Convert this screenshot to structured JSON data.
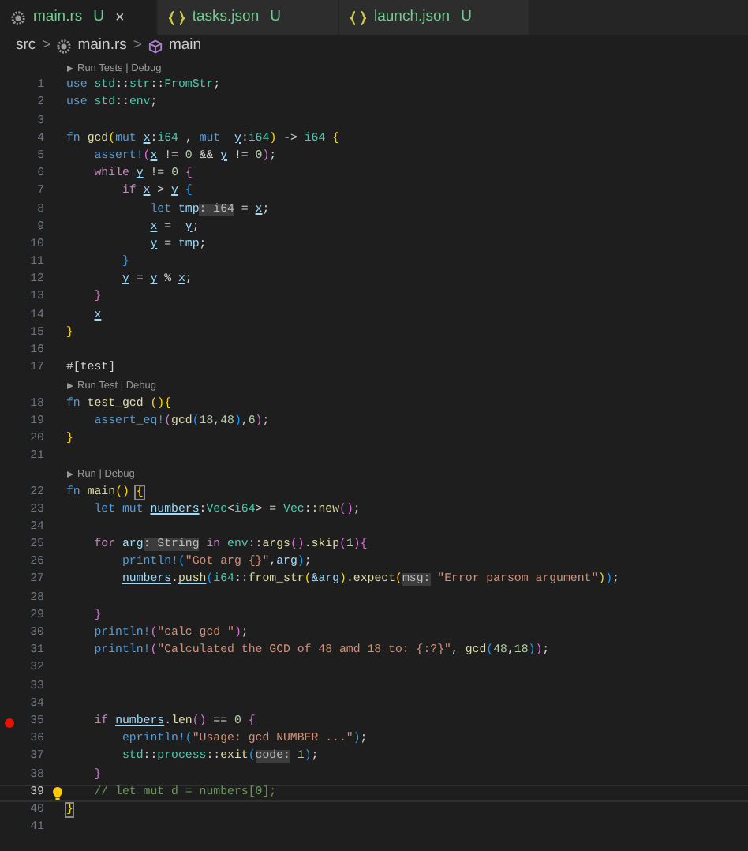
{
  "tabs": [
    {
      "kind": "rust",
      "label": "main.rs",
      "status": "U",
      "close": "×",
      "selected": true
    },
    {
      "kind": "json",
      "label": "tasks.json",
      "status": "U",
      "selected": false
    },
    {
      "kind": "json",
      "label": "launch.json",
      "status": "U",
      "selected": false
    }
  ],
  "breadcrumb": [
    {
      "kind": "folder",
      "label": "src"
    },
    {
      "kind": "file",
      "label": "main.rs"
    },
    {
      "kind": "symbol",
      "label": "main"
    }
  ],
  "breadcrumb_separator": ">",
  "lines": [
    {
      "kind": "codelens",
      "text": "Run Tests | Debug"
    },
    {
      "kind": "code",
      "num": "1",
      "breakpoint": false,
      "current": false,
      "t": [
        {
          "text": "use ",
          "kind": "kw"
        },
        {
          "text": "std",
          "kind": "ty"
        },
        {
          "text": "::",
          "kind": "p"
        },
        {
          "text": "str",
          "kind": "ty"
        },
        {
          "text": "::",
          "kind": "p"
        },
        {
          "text": "FromStr",
          "kind": "ty"
        },
        {
          "text": ";",
          "kind": "p"
        }
      ]
    },
    {
      "kind": "code",
      "num": "2",
      "breakpoint": false,
      "current": false,
      "t": [
        {
          "text": "use ",
          "kind": "kw"
        },
        {
          "text": "std",
          "kind": "ty"
        },
        {
          "text": "::",
          "kind": "p"
        },
        {
          "text": "env",
          "kind": "ty"
        },
        {
          "text": ";",
          "kind": "p"
        }
      ]
    },
    {
      "kind": "code",
      "num": "3",
      "breakpoint": false,
      "current": false
    },
    {
      "kind": "code",
      "num": "4",
      "breakpoint": false,
      "current": false,
      "t": [
        {
          "text": "fn ",
          "kind": "kw"
        },
        {
          "text": "gcd",
          "kind": "fn"
        },
        {
          "text": "(",
          "kind": "b1"
        },
        {
          "text": "mut ",
          "kind": "kw"
        },
        {
          "text": "x",
          "kind": "mv"
        },
        {
          "text": ":",
          "kind": "p"
        },
        {
          "text": "i64",
          "kind": "ty"
        },
        {
          "text": " , ",
          "kind": "p"
        },
        {
          "text": "mut  ",
          "kind": "kw"
        },
        {
          "text": "y",
          "kind": "mv"
        },
        {
          "text": ":",
          "kind": "p"
        },
        {
          "text": "i64",
          "kind": "ty"
        },
        {
          "text": ")",
          "kind": "b1"
        },
        {
          "text": " -> ",
          "kind": "p"
        },
        {
          "text": "i64 ",
          "kind": "ty"
        },
        {
          "text": "{",
          "kind": "b1"
        }
      ]
    },
    {
      "kind": "code",
      "num": "5",
      "breakpoint": false,
      "current": false,
      "t": [
        {
          "text": "    assert!",
          "kind": "mac"
        },
        {
          "text": "(",
          "kind": "b2"
        },
        {
          "text": "x",
          "kind": "mv"
        },
        {
          "text": " != ",
          "kind": "p"
        },
        {
          "text": "0",
          "kind": "num"
        },
        {
          "text": " && ",
          "kind": "p"
        },
        {
          "text": "y",
          "kind": "mv"
        },
        {
          "text": " != ",
          "kind": "p"
        },
        {
          "text": "0",
          "kind": "num"
        },
        {
          "text": ")",
          "kind": "b2"
        },
        {
          "text": ";",
          "kind": "p"
        }
      ]
    },
    {
      "kind": "code",
      "num": "6",
      "breakpoint": false,
      "current": false,
      "t": [
        {
          "text": "    while ",
          "kind": "ctl"
        },
        {
          "text": "y",
          "kind": "mv"
        },
        {
          "text": " != ",
          "kind": "p"
        },
        {
          "text": "0 ",
          "kind": "num"
        },
        {
          "text": "{",
          "kind": "b2"
        }
      ]
    },
    {
      "kind": "code",
      "num": "7",
      "breakpoint": false,
      "current": false,
      "t": [
        {
          "text": "        if ",
          "kind": "ctl"
        },
        {
          "text": "x",
          "kind": "mv"
        },
        {
          "text": " > ",
          "kind": "p"
        },
        {
          "text": "y",
          "kind": "mv"
        },
        {
          "text": " {",
          "kind": "b3"
        }
      ]
    },
    {
      "kind": "code",
      "num": "8",
      "breakpoint": false,
      "current": false,
      "t": [
        {
          "text": "            let ",
          "kind": "kw"
        },
        {
          "text": "tmp",
          "kind": "v"
        },
        {
          "text": ": i64",
          "kind": "hint"
        },
        {
          "text": " = ",
          "kind": "p"
        },
        {
          "text": "x",
          "kind": "mv"
        },
        {
          "text": ";",
          "kind": "p"
        }
      ]
    },
    {
      "kind": "code",
      "num": "9",
      "breakpoint": false,
      "current": false,
      "t": [
        {
          "text": "            x",
          "kind": "mv"
        },
        {
          "text": " =  ",
          "kind": "p"
        },
        {
          "text": "y",
          "kind": "mv"
        },
        {
          "text": ";",
          "kind": "p"
        }
      ]
    },
    {
      "kind": "code",
      "num": "10",
      "breakpoint": false,
      "current": false,
      "t": [
        {
          "text": "            y",
          "kind": "mv"
        },
        {
          "text": " = ",
          "kind": "p"
        },
        {
          "text": "tmp",
          "kind": "v"
        },
        {
          "text": ";",
          "kind": "p"
        }
      ]
    },
    {
      "kind": "code",
      "num": "11",
      "breakpoint": false,
      "current": false,
      "t": [
        {
          "text": "        }",
          "kind": "b3"
        }
      ]
    },
    {
      "kind": "code",
      "num": "12",
      "breakpoint": false,
      "current": false,
      "t": [
        {
          "text": "        y",
          "kind": "mv"
        },
        {
          "text": " = ",
          "kind": "p"
        },
        {
          "text": "y",
          "kind": "mv"
        },
        {
          "text": " % ",
          "kind": "p"
        },
        {
          "text": "x",
          "kind": "mv"
        },
        {
          "text": ";",
          "kind": "p"
        }
      ]
    },
    {
      "kind": "code",
      "num": "13",
      "breakpoint": false,
      "current": false,
      "t": [
        {
          "text": "    }",
          "kind": "b2"
        }
      ]
    },
    {
      "kind": "code",
      "num": "14",
      "breakpoint": false,
      "current": false,
      "t": [
        {
          "text": "    x",
          "kind": "mv"
        }
      ]
    },
    {
      "kind": "code",
      "num": "15",
      "breakpoint": false,
      "current": false,
      "t": [
        {
          "text": "}",
          "kind": "b1"
        }
      ]
    },
    {
      "kind": "code",
      "num": "16",
      "breakpoint": false,
      "current": false
    },
    {
      "kind": "code",
      "num": "17",
      "breakpoint": false,
      "current": false,
      "t": [
        {
          "text": "#[test]",
          "kind": "p"
        }
      ]
    },
    {
      "kind": "codelens",
      "text": "Run Test | Debug"
    },
    {
      "kind": "code",
      "num": "18",
      "breakpoint": false,
      "current": false,
      "t": [
        {
          "text": "fn ",
          "kind": "kw"
        },
        {
          "text": "test_gcd ",
          "kind": "fn"
        },
        {
          "text": "(){",
          "kind": "b1"
        }
      ]
    },
    {
      "kind": "code",
      "num": "19",
      "breakpoint": false,
      "current": false,
      "t": [
        {
          "text": "    assert_eq!",
          "kind": "mac"
        },
        {
          "text": "(",
          "kind": "b2"
        },
        {
          "text": "gcd",
          "kind": "fn"
        },
        {
          "text": "(",
          "kind": "b3"
        },
        {
          "text": "18",
          "kind": "num"
        },
        {
          "text": ",",
          "kind": "p"
        },
        {
          "text": "48",
          "kind": "num"
        },
        {
          "text": ")",
          "kind": "b3"
        },
        {
          "text": ",",
          "kind": "p"
        },
        {
          "text": "6",
          "kind": "num"
        },
        {
          "text": ")",
          "kind": "b2"
        },
        {
          "text": ";",
          "kind": "p"
        }
      ]
    },
    {
      "kind": "code",
      "num": "20",
      "breakpoint": false,
      "current": false,
      "t": [
        {
          "text": "}",
          "kind": "b1"
        }
      ]
    },
    {
      "kind": "code",
      "num": "21",
      "breakpoint": false,
      "current": false
    },
    {
      "kind": "codelens",
      "text": "Run | Debug"
    },
    {
      "kind": "code",
      "num": "22",
      "breakpoint": false,
      "current": false,
      "t": [
        {
          "text": "fn ",
          "kind": "kw"
        },
        {
          "text": "main",
          "kind": "fn"
        },
        {
          "text": "() ",
          "kind": "b1"
        },
        {
          "text": "{",
          "kind": "bm"
        }
      ]
    },
    {
      "kind": "code",
      "num": "23",
      "breakpoint": false,
      "current": false,
      "t": [
        {
          "text": "    let mut ",
          "kind": "kw"
        },
        {
          "text": "numbers",
          "kind": "mv"
        },
        {
          "text": ":",
          "kind": "p"
        },
        {
          "text": "Vec",
          "kind": "ty"
        },
        {
          "text": "<",
          "kind": "p"
        },
        {
          "text": "i64",
          "kind": "ty"
        },
        {
          "text": "> = ",
          "kind": "p"
        },
        {
          "text": "Vec",
          "kind": "ty"
        },
        {
          "text": "::",
          "kind": "p"
        },
        {
          "text": "new",
          "kind": "fn"
        },
        {
          "text": "()",
          "kind": "b2"
        },
        {
          "text": ";",
          "kind": "p"
        }
      ]
    },
    {
      "kind": "code",
      "num": "24",
      "breakpoint": false,
      "current": false
    },
    {
      "kind": "code",
      "num": "25",
      "breakpoint": false,
      "current": false,
      "t": [
        {
          "text": "    for ",
          "kind": "ctl"
        },
        {
          "text": "arg",
          "kind": "v"
        },
        {
          "text": ": String",
          "kind": "hint"
        },
        {
          "text": " in ",
          "kind": "ctl"
        },
        {
          "text": "env",
          "kind": "ty"
        },
        {
          "text": "::",
          "kind": "p"
        },
        {
          "text": "args",
          "kind": "fn"
        },
        {
          "text": "()",
          "kind": "b2"
        },
        {
          "text": ".",
          "kind": "p"
        },
        {
          "text": "skip",
          "kind": "fn"
        },
        {
          "text": "(",
          "kind": "b2"
        },
        {
          "text": "1",
          "kind": "num"
        },
        {
          "text": ")",
          "kind": "b2"
        },
        {
          "text": "{",
          "kind": "b2"
        }
      ]
    },
    {
      "kind": "code",
      "num": "26",
      "breakpoint": false,
      "current": false,
      "t": [
        {
          "text": "        println!",
          "kind": "mac"
        },
        {
          "text": "(",
          "kind": "b3"
        },
        {
          "text": "\"Got arg {}\"",
          "kind": "str"
        },
        {
          "text": ",",
          "kind": "p"
        },
        {
          "text": "arg",
          "kind": "v"
        },
        {
          "text": ")",
          "kind": "b3"
        },
        {
          "text": ";",
          "kind": "p"
        }
      ]
    },
    {
      "kind": "code",
      "num": "27",
      "breakpoint": false,
      "current": false,
      "t": [
        {
          "text": "        numbers",
          "kind": "mv"
        },
        {
          "text": ".",
          "kind": "p"
        },
        {
          "text": "push",
          "kind": "fnu"
        },
        {
          "text": "(",
          "kind": "b3"
        },
        {
          "text": "i64",
          "kind": "ty"
        },
        {
          "text": "::",
          "kind": "p"
        },
        {
          "text": "from_str",
          "kind": "fn"
        },
        {
          "text": "(",
          "kind": "b1"
        },
        {
          "text": "&arg",
          "kind": "v"
        },
        {
          "text": ")",
          "kind": "b1"
        },
        {
          "text": ".",
          "kind": "p"
        },
        {
          "text": "expect",
          "kind": "fn"
        },
        {
          "text": "(",
          "kind": "b1"
        },
        {
          "text": "msg:",
          "kind": "hint"
        },
        {
          "text": " \"Error parsom argument\"",
          "kind": "str"
        },
        {
          "text": ")",
          "kind": "b1"
        },
        {
          "text": ")",
          "kind": "b3"
        },
        {
          "text": ";",
          "kind": "p"
        }
      ]
    },
    {
      "kind": "code",
      "num": "28",
      "breakpoint": false,
      "current": false
    },
    {
      "kind": "code",
      "num": "29",
      "breakpoint": false,
      "current": false,
      "t": [
        {
          "text": "    }",
          "kind": "b2"
        }
      ]
    },
    {
      "kind": "code",
      "num": "30",
      "breakpoint": false,
      "current": false,
      "t": [
        {
          "text": "    println!",
          "kind": "mac"
        },
        {
          "text": "(",
          "kind": "b2"
        },
        {
          "text": "\"calc gcd \"",
          "kind": "str"
        },
        {
          "text": ")",
          "kind": "b2"
        },
        {
          "text": ";",
          "kind": "p"
        }
      ]
    },
    {
      "kind": "code",
      "num": "31",
      "breakpoint": false,
      "current": false,
      "t": [
        {
          "text": "    println!",
          "kind": "mac"
        },
        {
          "text": "(",
          "kind": "b2"
        },
        {
          "text": "\"Calculated the GCD of 48 amd 18 to: {:?}\"",
          "kind": "str"
        },
        {
          "text": ", ",
          "kind": "p"
        },
        {
          "text": "gcd",
          "kind": "fn"
        },
        {
          "text": "(",
          "kind": "b3"
        },
        {
          "text": "48",
          "kind": "num"
        },
        {
          "text": ",",
          "kind": "p"
        },
        {
          "text": "18",
          "kind": "num"
        },
        {
          "text": ")",
          "kind": "b3"
        },
        {
          "text": ")",
          "kind": "b2"
        },
        {
          "text": ";",
          "kind": "p"
        }
      ]
    },
    {
      "kind": "code",
      "num": "32",
      "breakpoint": false,
      "current": false
    },
    {
      "kind": "code",
      "num": "33",
      "breakpoint": false,
      "current": false
    },
    {
      "kind": "code",
      "num": "34",
      "breakpoint": false,
      "current": false
    },
    {
      "kind": "code",
      "num": "35",
      "breakpoint": true,
      "current": false,
      "t": [
        {
          "text": "    if ",
          "kind": "ctl"
        },
        {
          "text": "numbers",
          "kind": "mv"
        },
        {
          "text": ".",
          "kind": "p"
        },
        {
          "text": "len",
          "kind": "fn"
        },
        {
          "text": "()",
          "kind": "b2"
        },
        {
          "text": " == ",
          "kind": "p"
        },
        {
          "text": "0 ",
          "kind": "num"
        },
        {
          "text": "{",
          "kind": "b2"
        }
      ]
    },
    {
      "kind": "code",
      "num": "36",
      "breakpoint": false,
      "current": false,
      "t": [
        {
          "text": "        eprintln!",
          "kind": "mac"
        },
        {
          "text": "(",
          "kind": "b3"
        },
        {
          "text": "\"Usage: gcd NUMBER ...\"",
          "kind": "str"
        },
        {
          "text": ")",
          "kind": "b3"
        },
        {
          "text": ";",
          "kind": "p"
        }
      ]
    },
    {
      "kind": "code",
      "num": "37",
      "breakpoint": false,
      "current": false,
      "t": [
        {
          "text": "        std",
          "kind": "ty"
        },
        {
          "text": "::",
          "kind": "p"
        },
        {
          "text": "process",
          "kind": "ty"
        },
        {
          "text": "::",
          "kind": "p"
        },
        {
          "text": "exit",
          "kind": "fn"
        },
        {
          "text": "(",
          "kind": "b3"
        },
        {
          "text": "code:",
          "kind": "hint"
        },
        {
          "text": " 1",
          "kind": "num"
        },
        {
          "text": ")",
          "kind": "b3"
        },
        {
          "text": ";",
          "kind": "p"
        }
      ]
    },
    {
      "kind": "code",
      "num": "38",
      "breakpoint": false,
      "current": false,
      "t": [
        {
          "text": "    }",
          "kind": "b2"
        }
      ]
    },
    {
      "kind": "code",
      "num": "39",
      "breakpoint": false,
      "current": true,
      "t": [
        {
          "text": "    // let mut d = numbers[0];",
          "kind": "cm"
        }
      ]
    },
    {
      "kind": "code",
      "num": "40",
      "breakpoint": false,
      "current": false,
      "t": [
        {
          "text": "}",
          "kind": "bm"
        }
      ]
    },
    {
      "kind": "code",
      "num": "41",
      "breakpoint": false,
      "current": false
    }
  ]
}
